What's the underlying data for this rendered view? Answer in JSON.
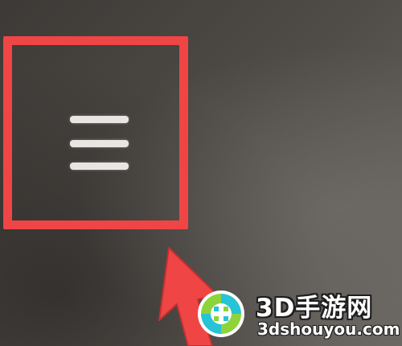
{
  "screen": {
    "background": "#4a4643"
  },
  "highlight": {
    "color": "#f04545"
  },
  "menu_button": {
    "icon": "hamburger-menu-icon",
    "color": "#e8e6e2"
  },
  "arrow": {
    "icon": "pointer-arrow-icon",
    "color": "#f04545"
  },
  "watermark": {
    "title": "3D手游网",
    "url": "3dshouyou.com",
    "logo_icon": "3dshouyou-logo-icon",
    "logo_colors": [
      "#27c3d6",
      "#8ed33a"
    ]
  }
}
